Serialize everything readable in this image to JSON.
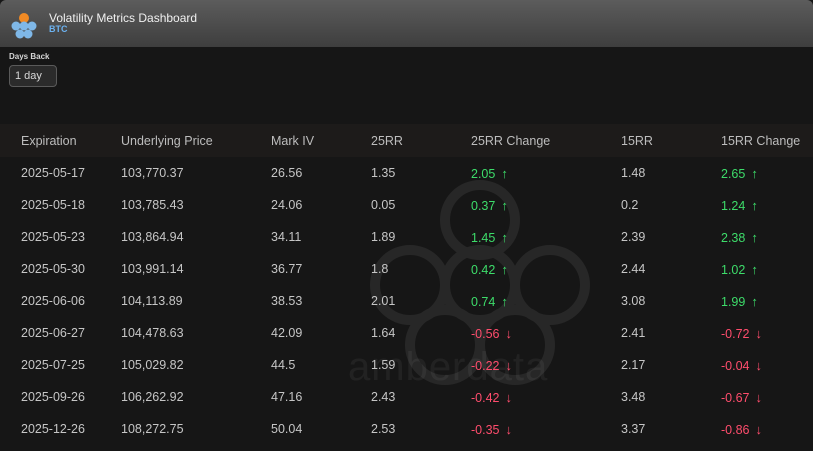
{
  "app": {
    "title": "Volatility Metrics Dashboard",
    "asset": "BTC"
  },
  "filters": {
    "days_back_label": "Days Back",
    "days_back_value": "1 day"
  },
  "colors": {
    "positive": "#3ddc6a",
    "negative": "#ff4d6d",
    "accent": "#6cb2f0"
  },
  "table": {
    "columns": [
      "Expiration",
      "Underlying Price",
      "Mark IV",
      "25RR",
      "25RR Change",
      "15RR",
      "15RR Change"
    ],
    "rows": [
      {
        "expiration": "2025-05-17",
        "price": "103,770.37",
        "mark_iv": "26.56",
        "rr25": "1.35",
        "rr25_change": "2.05",
        "rr25_dir": "up",
        "rr15": "1.48",
        "rr15_change": "2.65",
        "rr15_dir": "up"
      },
      {
        "expiration": "2025-05-18",
        "price": "103,785.43",
        "mark_iv": "24.06",
        "rr25": "0.05",
        "rr25_change": "0.37",
        "rr25_dir": "up",
        "rr15": "0.2",
        "rr15_change": "1.24",
        "rr15_dir": "up"
      },
      {
        "expiration": "2025-05-23",
        "price": "103,864.94",
        "mark_iv": "34.11",
        "rr25": "1.89",
        "rr25_change": "1.45",
        "rr25_dir": "up",
        "rr15": "2.39",
        "rr15_change": "2.38",
        "rr15_dir": "up"
      },
      {
        "expiration": "2025-05-30",
        "price": "103,991.14",
        "mark_iv": "36.77",
        "rr25": "1.8",
        "rr25_change": "0.42",
        "rr25_dir": "up",
        "rr15": "2.44",
        "rr15_change": "1.02",
        "rr15_dir": "up"
      },
      {
        "expiration": "2025-06-06",
        "price": "104,113.89",
        "mark_iv": "38.53",
        "rr25": "2.01",
        "rr25_change": "0.74",
        "rr25_dir": "up",
        "rr15": "3.08",
        "rr15_change": "1.99",
        "rr15_dir": "up"
      },
      {
        "expiration": "2025-06-27",
        "price": "104,478.63",
        "mark_iv": "42.09",
        "rr25": "1.64",
        "rr25_change": "-0.56",
        "rr25_dir": "down",
        "rr15": "2.41",
        "rr15_change": "-0.72",
        "rr15_dir": "down"
      },
      {
        "expiration": "2025-07-25",
        "price": "105,029.82",
        "mark_iv": "44.5",
        "rr25": "1.59",
        "rr25_change": "-0.22",
        "rr25_dir": "down",
        "rr15": "2.17",
        "rr15_change": "-0.04",
        "rr15_dir": "down"
      },
      {
        "expiration": "2025-09-26",
        "price": "106,262.92",
        "mark_iv": "47.16",
        "rr25": "2.43",
        "rr25_change": "-0.42",
        "rr25_dir": "down",
        "rr15": "3.48",
        "rr15_change": "-0.67",
        "rr15_dir": "down"
      },
      {
        "expiration": "2025-12-26",
        "price": "108,272.75",
        "mark_iv": "50.04",
        "rr25": "2.53",
        "rr25_change": "-0.35",
        "rr25_dir": "down",
        "rr15": "3.37",
        "rr15_change": "-0.86",
        "rr15_dir": "down"
      }
    ]
  },
  "watermark": {
    "text": "amberdata"
  }
}
